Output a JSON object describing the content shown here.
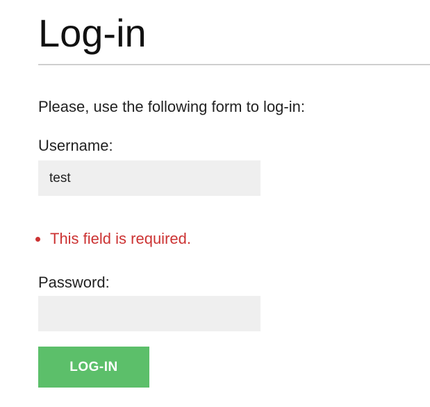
{
  "page": {
    "title": "Log-in",
    "intro": "Please, use the following form to log-in:"
  },
  "form": {
    "username_label": "Username:",
    "username_value": "test",
    "username_errors": [
      "This field is required."
    ],
    "password_label": "Password:",
    "password_value": "",
    "submit_label": "LOG-IN"
  },
  "colors": {
    "error": "#cc3333",
    "submit_background": "#5cbf6a",
    "input_background": "#efefef",
    "divider": "#cfcfcf"
  }
}
